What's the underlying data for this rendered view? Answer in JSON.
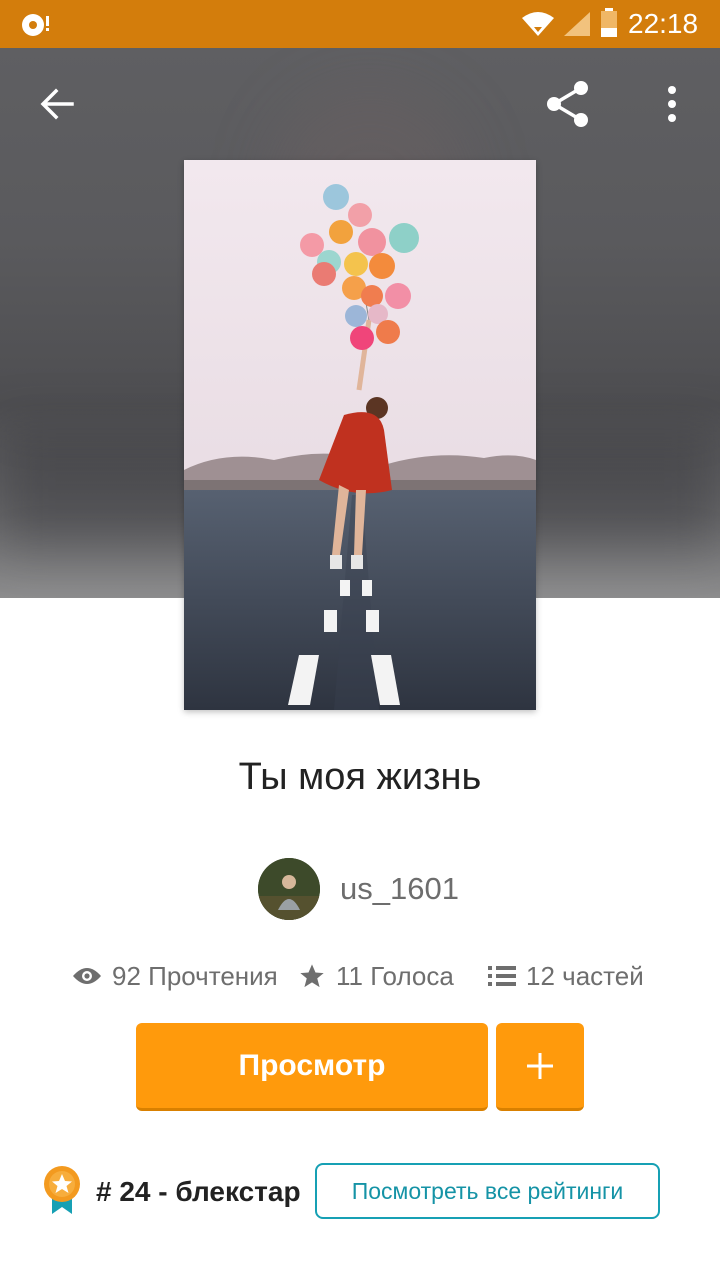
{
  "status_bar": {
    "time": "22:18",
    "icons": [
      "notification-app-icon",
      "wifi-icon",
      "signal-icon",
      "battery-icon"
    ]
  },
  "toolbar": {
    "icons": [
      "back-arrow-icon",
      "share-icon",
      "more-vert-icon"
    ]
  },
  "story": {
    "title": "Ты моя жизнь",
    "author": "us_1601",
    "stats": {
      "reads": "92 Прочтения",
      "votes": "11 Голоса",
      "parts": "12 частей"
    }
  },
  "actions": {
    "read_label": "Просмотр",
    "add_label": "+"
  },
  "ranking": {
    "text": "# 24 - блекстар",
    "button_label": "Посмотреть все рейтинги"
  },
  "colors": {
    "status_bar": "#d37d0c",
    "accent": "#ff9a0c",
    "link": "#16a0b4"
  }
}
